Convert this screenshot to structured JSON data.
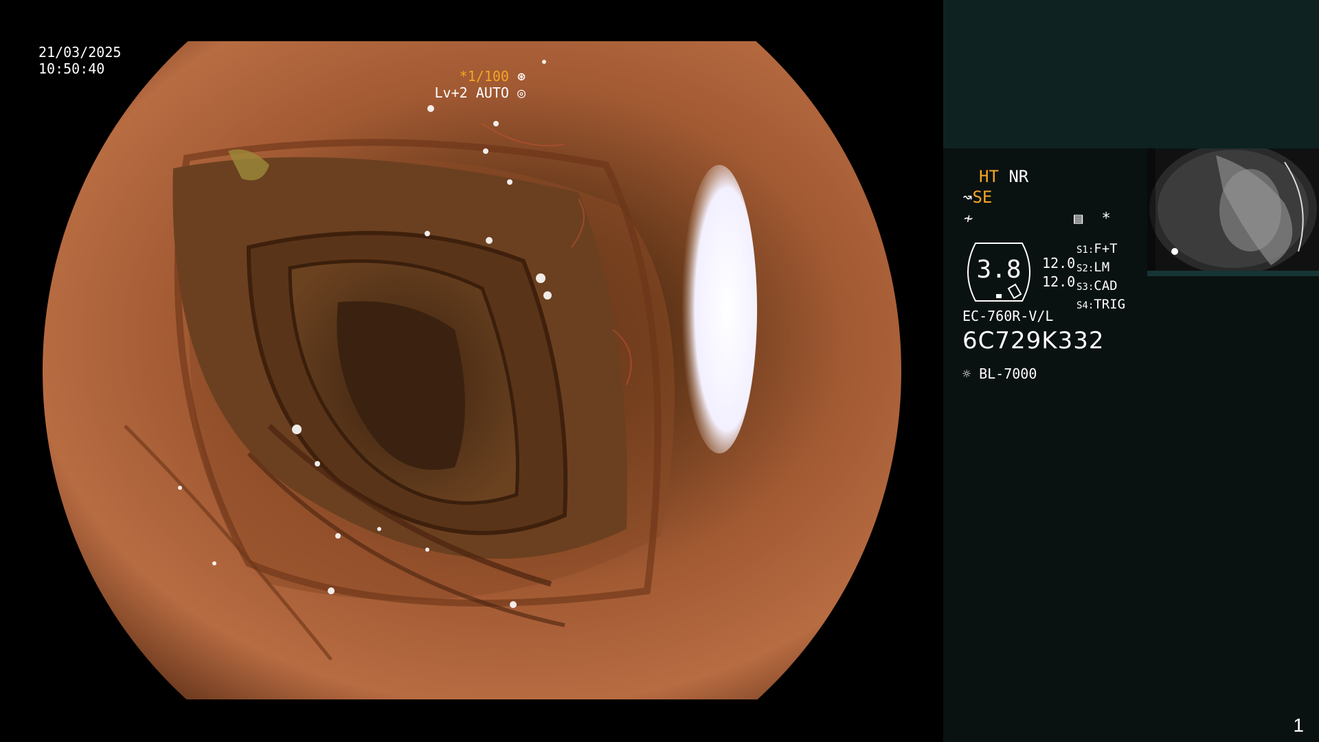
{
  "osd": {
    "date": "21/03/2025",
    "time": "10:50:40",
    "shutter": "*1/100",
    "shutter_icon": "aperture-icon",
    "level": "Lv+2",
    "mode": "AUTO",
    "mode_icon": "iris-icon"
  },
  "panel": {
    "ht": "HT",
    "nr": "NR",
    "se": "SE",
    "se_icon": "scope-icon",
    "enhance_icon": "waveform-icon",
    "menu_icon": "settings-icon",
    "star": "*",
    "gauge_value": "3.8",
    "level_a": "12.0",
    "level_b": "12.0",
    "switches": [
      {
        "key": "S1:",
        "value": "F+T"
      },
      {
        "key": "S2:",
        "value": "LM"
      },
      {
        "key": "S3:",
        "value": "CAD"
      },
      {
        "key": "S4:",
        "value": "TRIG"
      }
    ],
    "scope_model": "EC-760R-V/L",
    "serial": "6C729K332",
    "light_source": "BL-7000",
    "light_icon": "sun-icon"
  },
  "page_number": "1",
  "colors": {
    "accent_orange": "#f5a623",
    "panel_bg": "#0a1111",
    "panel_top_bg": "#0e2222"
  }
}
